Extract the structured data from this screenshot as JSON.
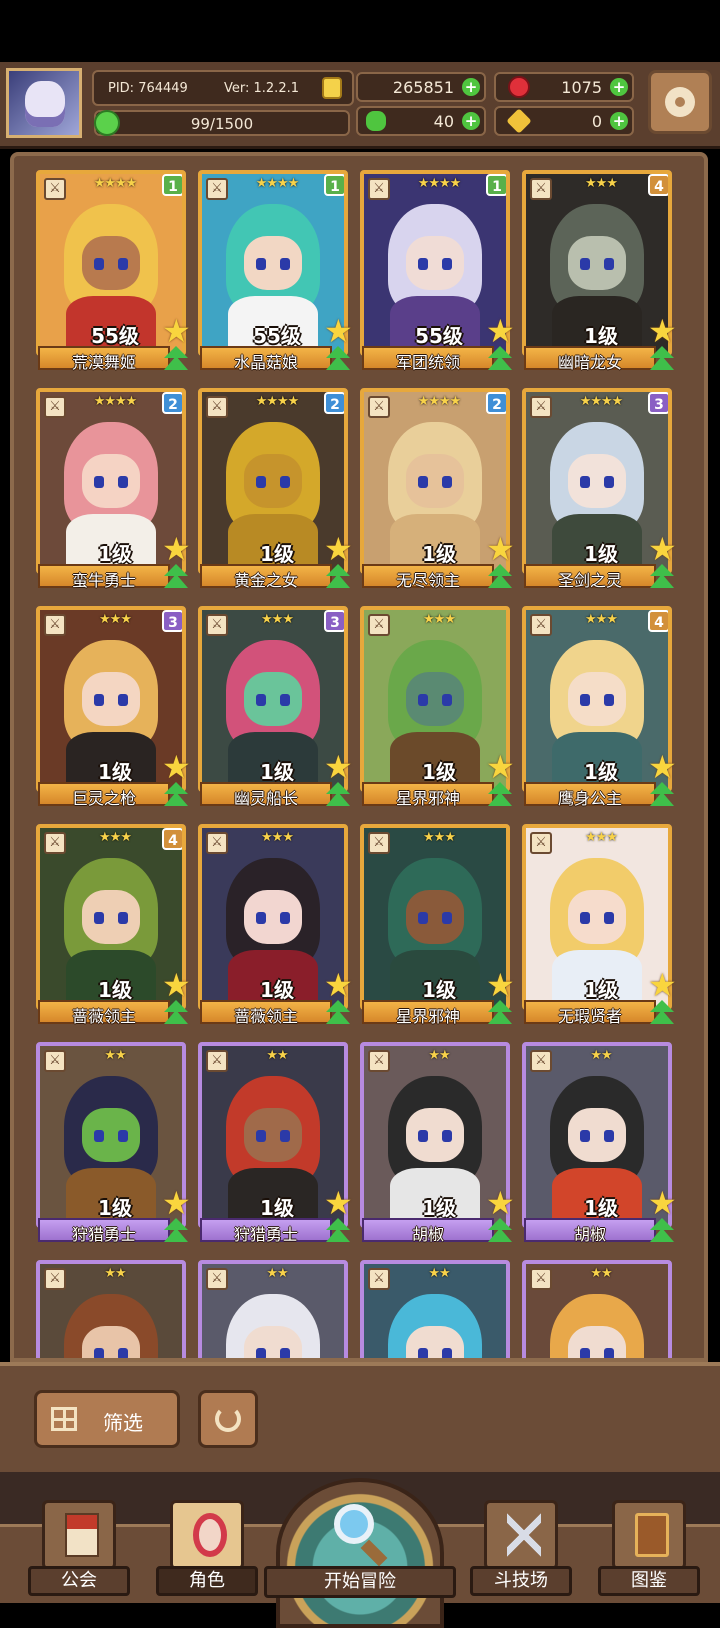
{
  "player": {
    "pid": "PID: 764449",
    "version": "Ver: 1.2.2.1",
    "exp": "99/1500"
  },
  "resources": {
    "gold": "265851",
    "gems": "1075",
    "clover": "40",
    "keys": "0"
  },
  "cards": [
    {
      "name": "荒漠舞姬",
      "level": "55级",
      "stars": "★★★★",
      "badge": "1",
      "badge_color": "#59b04a",
      "frame": "gold",
      "hair": "#f0c24c",
      "skin": "#b87a4e",
      "body": "#c2352c",
      "bg": "#e8a14a"
    },
    {
      "name": "水晶菇娘",
      "level": "55级",
      "stars": "★★★★",
      "badge": "1",
      "badge_color": "#59b04a",
      "frame": "gold",
      "hair": "#42c6b4",
      "skin": "#f2d7c4",
      "body": "#f4f4f4",
      "bg": "#3fa4c4"
    },
    {
      "name": "军团统领",
      "level": "55级",
      "stars": "★★★★",
      "badge": "1",
      "badge_color": "#59b04a",
      "frame": "gold",
      "hair": "#d8d4ee",
      "skin": "#f0dcd6",
      "body": "#5a3f8a",
      "bg": "#3b3572"
    },
    {
      "name": "幽暗龙女",
      "level": "1级",
      "stars": "★★★",
      "badge": "4",
      "badge_color": "#d2903a",
      "frame": "gold",
      "hair": "#5c6458",
      "skin": "#b9bfae",
      "body": "#2a2622",
      "bg": "#2e2b28"
    },
    {
      "name": "蛮牛勇士",
      "level": "1级",
      "stars": "★★★★",
      "badge": "2",
      "badge_color": "#3f8fd6",
      "frame": "gold",
      "hair": "#e8949a",
      "skin": "#f5d3c4",
      "body": "#f3efe8",
      "bg": "#6d4a3a"
    },
    {
      "name": "黄金之女",
      "level": "1级",
      "stars": "★★★★",
      "badge": "2",
      "badge_color": "#3f8fd6",
      "frame": "gold",
      "hair": "#d4a82a",
      "skin": "#c6942c",
      "body": "#b88a24",
      "bg": "#4a3a2c"
    },
    {
      "name": "无尽领主",
      "level": "1级",
      "stars": "★★★★",
      "badge": "2",
      "badge_color": "#3f8fd6",
      "frame": "gold",
      "hair": "#e9cf9a",
      "skin": "#e6c29a",
      "body": "#d6b07a",
      "bg": "#c8a070"
    },
    {
      "name": "圣剑之灵",
      "level": "1级",
      "stars": "★★★★",
      "badge": "3",
      "badge_color": "#8a5fc4",
      "frame": "gold",
      "hair": "#c9d6e4",
      "skin": "#f2e2da",
      "body": "#3e4a3c",
      "bg": "#5a5c52"
    },
    {
      "name": "巨灵之枪",
      "level": "1级",
      "stars": "★★★",
      "badge": "3",
      "badge_color": "#8a5fc4",
      "frame": "gold",
      "hair": "#e6b25a",
      "skin": "#f4d6c2",
      "body": "#2a2422",
      "bg": "#6a3a26"
    },
    {
      "name": "幽灵船长",
      "level": "1级",
      "stars": "★★★",
      "badge": "3",
      "badge_color": "#8a5fc4",
      "frame": "gold",
      "hair": "#d2527a",
      "skin": "#6ac49a",
      "body": "#2c3a3a",
      "bg": "#3c4a44"
    },
    {
      "name": "星界邪神",
      "level": "1级",
      "stars": "★★★",
      "badge": "",
      "badge_color": "#c44a3a",
      "frame": "gold",
      "hair": "#6aa84a",
      "skin": "#5a8a72",
      "body": "#6b4a2a",
      "bg": "#8aa85a"
    },
    {
      "name": "鹰身公主",
      "level": "1级",
      "stars": "★★★",
      "badge": "4",
      "badge_color": "#d2903a",
      "frame": "gold",
      "hair": "#f0d48c",
      "skin": "#f5ddc8",
      "body": "#3e6a6a",
      "bg": "#4a6a6a"
    },
    {
      "name": "蔷薇领主",
      "level": "1级",
      "stars": "★★★",
      "badge": "4",
      "badge_color": "#d2903a",
      "frame": "gold",
      "hair": "#7a9a3a",
      "skin": "#eecfb4",
      "body": "#2c4a2a",
      "bg": "#3a4a2c"
    },
    {
      "name": "蔷薇领主",
      "level": "1级",
      "stars": "★★★",
      "badge": "",
      "badge_color": "#000000",
      "frame": "gold",
      "hair": "#2a2228",
      "skin": "#f2d6d0",
      "body": "#8a1e2a",
      "bg": "#3a3a5a"
    },
    {
      "name": "星界邪神",
      "level": "1级",
      "stars": "★★★",
      "badge": "",
      "badge_color": "#6a5ad4",
      "frame": "gold",
      "hair": "#2e6a58",
      "skin": "#8a5a3a",
      "body": "#2a4a3e",
      "bg": "#2a4a44"
    },
    {
      "name": "无瑕贤者",
      "level": "1级",
      "stars": "★★★",
      "badge": "",
      "badge_color": "#000000",
      "frame": "gold",
      "hair": "#f2cc6a",
      "skin": "#f6dccc",
      "body": "#e8eef6",
      "bg": "#f2e6e0"
    },
    {
      "name": "狩猎勇士",
      "level": "1级",
      "stars": "★★",
      "badge": "",
      "badge_color": "#000000",
      "frame": "purple",
      "hair": "#2a2a4a",
      "skin": "#6ab44a",
      "body": "#8a5a2a",
      "bg": "#6a5440"
    },
    {
      "name": "狩猎勇士",
      "level": "1级",
      "stars": "★★",
      "badge": "",
      "badge_color": "#000000",
      "frame": "purple",
      "hair": "#c23a2a",
      "skin": "#a06a4a",
      "body": "#2a2624",
      "bg": "#3a3a4a"
    },
    {
      "name": "胡椒",
      "level": "1级",
      "stars": "★★",
      "badge": "",
      "badge_color": "#000000",
      "frame": "purple",
      "hair": "#2a2a2a",
      "skin": "#f0dcd0",
      "body": "#e6e6e6",
      "bg": "#6a5a5a"
    },
    {
      "name": "胡椒",
      "level": "1级",
      "stars": "★★",
      "badge": "",
      "badge_color": "#000000",
      "frame": "purple",
      "hair": "#2a2a2a",
      "skin": "#f0dcd0",
      "body": "#d2452a",
      "bg": "#5a5a6a"
    },
    {
      "name": "",
      "level": "",
      "stars": "★★",
      "badge": "",
      "badge_color": "#000000",
      "frame": "purple",
      "hair": "#8a4a2a",
      "skin": "#e8c4a8",
      "body": "#6a4a3a",
      "bg": "#5a4a3a"
    },
    {
      "name": "",
      "level": "",
      "stars": "★★",
      "badge": "",
      "badge_color": "#000000",
      "frame": "purple",
      "hair": "#e6e6ee",
      "skin": "#f0dcd0",
      "body": "#6a6a7a",
      "bg": "#5a5a6a"
    },
    {
      "name": "",
      "level": "",
      "stars": "★★",
      "badge": "",
      "badge_color": "#000000",
      "frame": "purple",
      "hair": "#4ab8d8",
      "skin": "#f0dcd0",
      "body": "#3a6a8a",
      "bg": "#3a5a6a"
    },
    {
      "name": "",
      "level": "",
      "stars": "★★",
      "badge": "",
      "badge_color": "#000000",
      "frame": "purple",
      "hair": "#e8a84a",
      "skin": "#f0dcd0",
      "body": "#8a5a3a",
      "bg": "#6a4a3a"
    }
  ],
  "controls": {
    "filter_label": "筛选"
  },
  "nav": {
    "guild": "公会",
    "character": "角色",
    "adventure": "开始冒险",
    "arena": "斗技场",
    "codex": "图鉴"
  }
}
